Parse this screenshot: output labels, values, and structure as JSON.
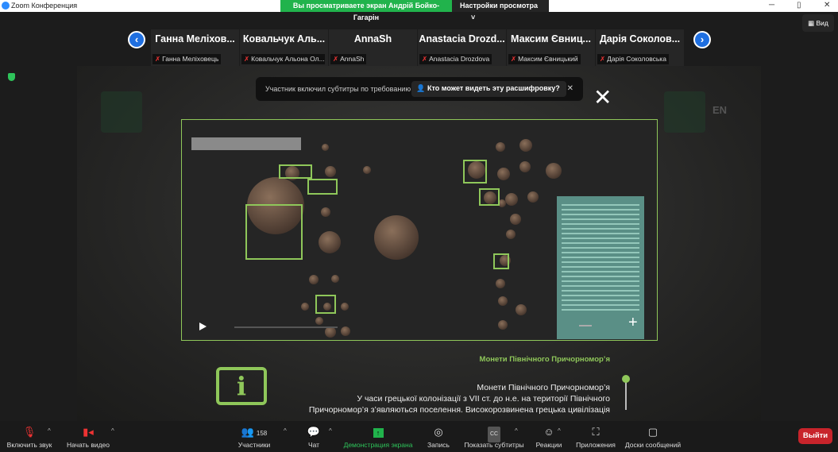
{
  "window": {
    "title": "Zoom Конференция",
    "banner": "Вы просматриваете экран Андрій Бойко-Гагарін",
    "view_options": "Настройки просмотра",
    "view_button": "Вид"
  },
  "participants": [
    {
      "display": "Ганна Меліхов...",
      "label": "Ганна Меліховець"
    },
    {
      "display": "Ковальчук Аль...",
      "label": "Ковальчук Альона Ол..."
    },
    {
      "display": "AnnaSh",
      "label": "AnnaSh"
    },
    {
      "display": "Anastacia Drozd...",
      "label": "Anastacia Drozdova"
    },
    {
      "display": "Максим Євниц...",
      "label": "Максим Євницький"
    },
    {
      "display": "Дарія Соколов...",
      "label": "Дарія Соколовська"
    }
  ],
  "caption_toast": {
    "message": "Участник включил субтитры по требованию",
    "who_can_see": "Кто может видеть эту расшифровку?"
  },
  "shared": {
    "ghost_lang": "EN",
    "heading": "Монети Північного Причорномор’я",
    "description": [
      "Монети Північного Причорномор’я",
      "У часи грецької колонізації з VII ст. до н.е. на території Північного",
      "Причорномор’я з’являються поселення. Високорозвинена грецька цивілізація"
    ]
  },
  "toolbar": {
    "unmute": "Включить звук",
    "start_video": "Начать видео",
    "participants": "Участники",
    "participants_count": "158",
    "chat": "Чат",
    "share_screen": "Демонстрация экрана",
    "record": "Запись",
    "captions": "Показать субтитры",
    "reactions": "Реакции",
    "apps": "Приложения",
    "whiteboards": "Доски сообщений",
    "leave": "Выйти"
  },
  "colors": {
    "accent_green": "#8fc75a",
    "zoom_blue": "#1f6fe0",
    "leave_red": "#c8242b",
    "banner_green": "#21b34c"
  }
}
